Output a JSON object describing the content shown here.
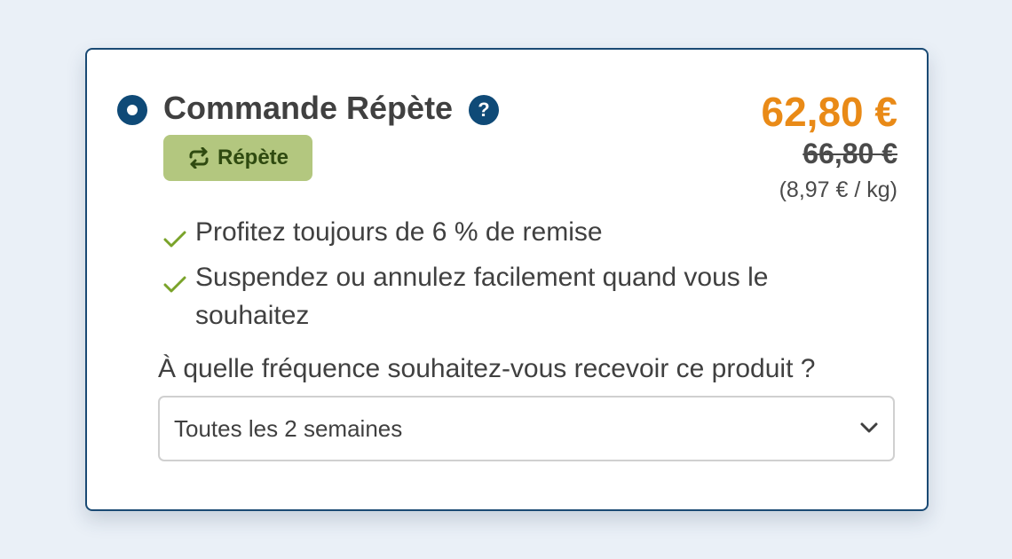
{
  "option": {
    "title": "Commande Répète",
    "help_icon": "question-mark-icon",
    "help_glyph": "?",
    "badge_label": "Répète",
    "badge_icon": "repeat-icon"
  },
  "pricing": {
    "price": "62,80 €",
    "old_price": "66,80 €",
    "unit_price": "(8,97 € / kg)"
  },
  "benefits": [
    "Profitez toujours de 6 % de remise",
    "Suspendez ou annulez facilement quand vous le souhaitez"
  ],
  "frequency": {
    "question": "À quelle fréquence souhaitez-vous recevoir ce produit ?",
    "selected": "Toutes les 2 semaines"
  },
  "colors": {
    "accent": "#0f4a77",
    "price": "#e98a17",
    "badge_bg": "#b3c77f",
    "check": "#7aa32a"
  }
}
